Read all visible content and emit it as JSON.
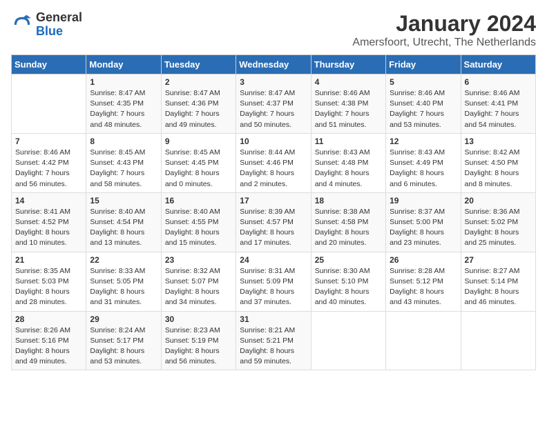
{
  "header": {
    "logo_general": "General",
    "logo_blue": "Blue",
    "title": "January 2024",
    "subtitle": "Amersfoort, Utrecht, The Netherlands"
  },
  "days_of_week": [
    "Sunday",
    "Monday",
    "Tuesday",
    "Wednesday",
    "Thursday",
    "Friday",
    "Saturday"
  ],
  "weeks": [
    [
      {
        "day": "",
        "info": ""
      },
      {
        "day": "1",
        "info": "Sunrise: 8:47 AM\nSunset: 4:35 PM\nDaylight: 7 hours\nand 48 minutes."
      },
      {
        "day": "2",
        "info": "Sunrise: 8:47 AM\nSunset: 4:36 PM\nDaylight: 7 hours\nand 49 minutes."
      },
      {
        "day": "3",
        "info": "Sunrise: 8:47 AM\nSunset: 4:37 PM\nDaylight: 7 hours\nand 50 minutes."
      },
      {
        "day": "4",
        "info": "Sunrise: 8:46 AM\nSunset: 4:38 PM\nDaylight: 7 hours\nand 51 minutes."
      },
      {
        "day": "5",
        "info": "Sunrise: 8:46 AM\nSunset: 4:40 PM\nDaylight: 7 hours\nand 53 minutes."
      },
      {
        "day": "6",
        "info": "Sunrise: 8:46 AM\nSunset: 4:41 PM\nDaylight: 7 hours\nand 54 minutes."
      }
    ],
    [
      {
        "day": "7",
        "info": "Sunrise: 8:46 AM\nSunset: 4:42 PM\nDaylight: 7 hours\nand 56 minutes."
      },
      {
        "day": "8",
        "info": "Sunrise: 8:45 AM\nSunset: 4:43 PM\nDaylight: 7 hours\nand 58 minutes."
      },
      {
        "day": "9",
        "info": "Sunrise: 8:45 AM\nSunset: 4:45 PM\nDaylight: 8 hours\nand 0 minutes."
      },
      {
        "day": "10",
        "info": "Sunrise: 8:44 AM\nSunset: 4:46 PM\nDaylight: 8 hours\nand 2 minutes."
      },
      {
        "day": "11",
        "info": "Sunrise: 8:43 AM\nSunset: 4:48 PM\nDaylight: 8 hours\nand 4 minutes."
      },
      {
        "day": "12",
        "info": "Sunrise: 8:43 AM\nSunset: 4:49 PM\nDaylight: 8 hours\nand 6 minutes."
      },
      {
        "day": "13",
        "info": "Sunrise: 8:42 AM\nSunset: 4:50 PM\nDaylight: 8 hours\nand 8 minutes."
      }
    ],
    [
      {
        "day": "14",
        "info": "Sunrise: 8:41 AM\nSunset: 4:52 PM\nDaylight: 8 hours\nand 10 minutes."
      },
      {
        "day": "15",
        "info": "Sunrise: 8:40 AM\nSunset: 4:54 PM\nDaylight: 8 hours\nand 13 minutes."
      },
      {
        "day": "16",
        "info": "Sunrise: 8:40 AM\nSunset: 4:55 PM\nDaylight: 8 hours\nand 15 minutes."
      },
      {
        "day": "17",
        "info": "Sunrise: 8:39 AM\nSunset: 4:57 PM\nDaylight: 8 hours\nand 17 minutes."
      },
      {
        "day": "18",
        "info": "Sunrise: 8:38 AM\nSunset: 4:58 PM\nDaylight: 8 hours\nand 20 minutes."
      },
      {
        "day": "19",
        "info": "Sunrise: 8:37 AM\nSunset: 5:00 PM\nDaylight: 8 hours\nand 23 minutes."
      },
      {
        "day": "20",
        "info": "Sunrise: 8:36 AM\nSunset: 5:02 PM\nDaylight: 8 hours\nand 25 minutes."
      }
    ],
    [
      {
        "day": "21",
        "info": "Sunrise: 8:35 AM\nSunset: 5:03 PM\nDaylight: 8 hours\nand 28 minutes."
      },
      {
        "day": "22",
        "info": "Sunrise: 8:33 AM\nSunset: 5:05 PM\nDaylight: 8 hours\nand 31 minutes."
      },
      {
        "day": "23",
        "info": "Sunrise: 8:32 AM\nSunset: 5:07 PM\nDaylight: 8 hours\nand 34 minutes."
      },
      {
        "day": "24",
        "info": "Sunrise: 8:31 AM\nSunset: 5:09 PM\nDaylight: 8 hours\nand 37 minutes."
      },
      {
        "day": "25",
        "info": "Sunrise: 8:30 AM\nSunset: 5:10 PM\nDaylight: 8 hours\nand 40 minutes."
      },
      {
        "day": "26",
        "info": "Sunrise: 8:28 AM\nSunset: 5:12 PM\nDaylight: 8 hours\nand 43 minutes."
      },
      {
        "day": "27",
        "info": "Sunrise: 8:27 AM\nSunset: 5:14 PM\nDaylight: 8 hours\nand 46 minutes."
      }
    ],
    [
      {
        "day": "28",
        "info": "Sunrise: 8:26 AM\nSunset: 5:16 PM\nDaylight: 8 hours\nand 49 minutes."
      },
      {
        "day": "29",
        "info": "Sunrise: 8:24 AM\nSunset: 5:17 PM\nDaylight: 8 hours\nand 53 minutes."
      },
      {
        "day": "30",
        "info": "Sunrise: 8:23 AM\nSunset: 5:19 PM\nDaylight: 8 hours\nand 56 minutes."
      },
      {
        "day": "31",
        "info": "Sunrise: 8:21 AM\nSunset: 5:21 PM\nDaylight: 8 hours\nand 59 minutes."
      },
      {
        "day": "",
        "info": ""
      },
      {
        "day": "",
        "info": ""
      },
      {
        "day": "",
        "info": ""
      }
    ]
  ]
}
